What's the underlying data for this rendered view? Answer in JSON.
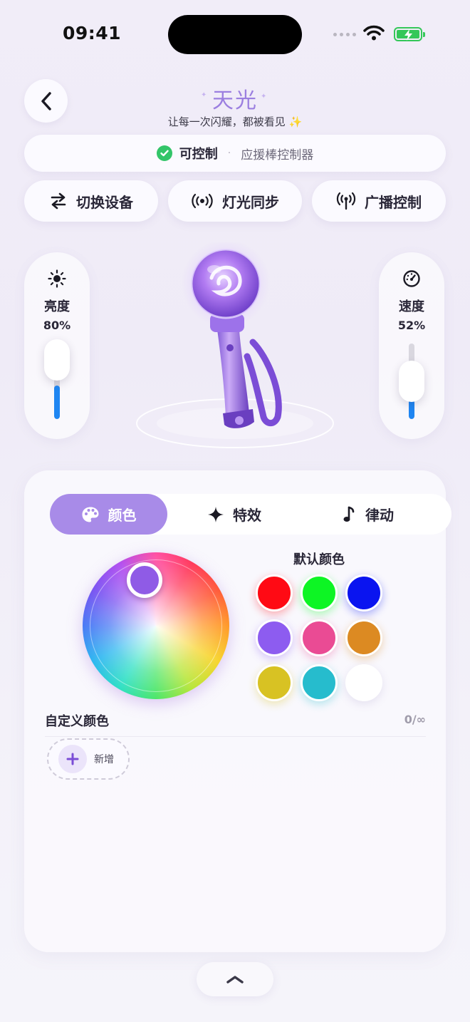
{
  "status_bar": {
    "time": "09:41"
  },
  "header": {
    "brand": "天光",
    "tagline": "让每一次闪耀，都被看见",
    "tagline_emoji": "✨"
  },
  "device_status": {
    "state": "可控制",
    "separator": "·",
    "description": "应援棒控制器"
  },
  "actions": [
    {
      "label": "切换设备",
      "icon": "swap-icon"
    },
    {
      "label": "灯光同步",
      "icon": "broadcast-waves-icon"
    },
    {
      "label": "广播控制",
      "icon": "antenna-icon"
    }
  ],
  "brightness": {
    "label": "亮度",
    "value_text": "80%",
    "value": 0.8,
    "icon": "sun-icon"
  },
  "speed": {
    "label": "速度",
    "value_text": "52%",
    "value": 0.52,
    "icon": "speedometer-icon"
  },
  "tabs": [
    {
      "label": "颜色",
      "icon": "palette-icon",
      "active": true
    },
    {
      "label": "特效",
      "icon": "sparkle-icon",
      "active": false
    },
    {
      "label": "律动",
      "icon": "music-note-icon",
      "active": false
    }
  ],
  "color_picker": {
    "selected_color": "#8f5be6"
  },
  "presets": {
    "title": "默认颜色",
    "colors": [
      "#ff0a14",
      "#0df524",
      "#0a14f0",
      "#8d5cf0",
      "#ea4b94",
      "#dc8a22",
      "#d8c223",
      "#26bccd",
      "#ffffff"
    ]
  },
  "custom": {
    "title": "自定义颜色",
    "count": "0/∞",
    "add_label": "新增"
  },
  "colors": {
    "accent": "#a88be8",
    "slider_fill": "#1f86f2",
    "ok_green": "#33c569"
  }
}
